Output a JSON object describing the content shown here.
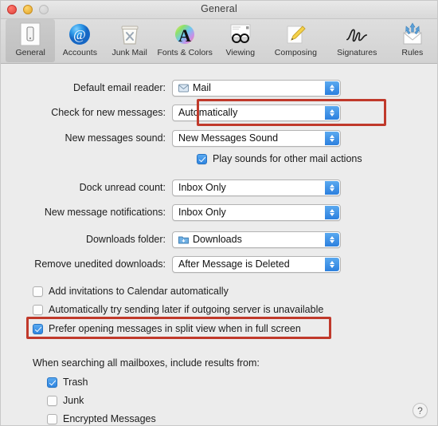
{
  "window": {
    "title": "General",
    "controls": [
      {
        "name": "close",
        "label": "Close"
      },
      {
        "name": "minimize",
        "label": "Minimize"
      },
      {
        "name": "zoom",
        "label": "Zoom"
      }
    ]
  },
  "toolbar": {
    "items": [
      {
        "label": "General",
        "icon": "general-icon",
        "selected": true
      },
      {
        "label": "Accounts",
        "icon": "accounts-at-icon",
        "selected": false
      },
      {
        "label": "Junk Mail",
        "icon": "junk-mail-trash-icon",
        "selected": false
      },
      {
        "label": "Fonts & Colors",
        "icon": "fonts-colors-icon",
        "selected": false
      },
      {
        "label": "Viewing",
        "icon": "viewing-glasses-icon",
        "selected": false
      },
      {
        "label": "Composing",
        "icon": "composing-pencil-icon",
        "selected": false
      },
      {
        "label": "Signatures",
        "icon": "signatures-icon",
        "selected": false
      },
      {
        "label": "Rules",
        "icon": "rules-envelope-icon",
        "selected": false
      }
    ]
  },
  "form": {
    "default_email_reader": {
      "label": "Default email reader:",
      "value": "Mail",
      "icon": "mail-app-icon"
    },
    "check_for_new_messages": {
      "label": "Check for new messages:",
      "value": "Automatically",
      "highlighted": true
    },
    "new_messages_sound": {
      "label": "New messages sound:",
      "value": "New Messages Sound"
    },
    "play_sounds": {
      "label": "Play sounds for other mail actions",
      "checked": true
    },
    "dock_unread_count": {
      "label": "Dock unread count:",
      "value": "Inbox Only"
    },
    "new_message_notifications": {
      "label": "New message notifications:",
      "value": "Inbox Only"
    },
    "downloads_folder": {
      "label": "Downloads folder:",
      "value": "Downloads",
      "icon": "downloads-folder-icon"
    },
    "remove_unedited_downloads": {
      "label": "Remove unedited downloads:",
      "value": "After Message is Deleted"
    }
  },
  "options": [
    {
      "label": "Add invitations to Calendar automatically",
      "checked": false,
      "highlighted": false
    },
    {
      "label": "Automatically try sending later if outgoing server is unavailable",
      "checked": false,
      "highlighted": false
    },
    {
      "label": "Prefer opening messages in split view when in full screen",
      "checked": true,
      "highlighted": true
    }
  ],
  "search_section": {
    "heading": "When searching all mailboxes, include results from:",
    "items": [
      {
        "label": "Trash",
        "checked": true
      },
      {
        "label": "Junk",
        "checked": false
      },
      {
        "label": "Encrypted Messages",
        "checked": false
      }
    ]
  },
  "help": {
    "label": "?"
  },
  "colors": {
    "accent": "#2f85e0",
    "highlight": "#c0392b",
    "window_bg": "#ececec"
  }
}
